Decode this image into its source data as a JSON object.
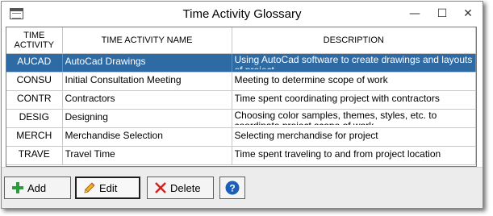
{
  "window": {
    "title": "Time Activity Glossary",
    "controls": {
      "minimize": "—",
      "maximize": "☐",
      "close": "✕"
    }
  },
  "table": {
    "columns": [
      "TIME ACTIVITY",
      "TIME ACTIVITY NAME",
      "DESCRIPTION"
    ],
    "rows": [
      {
        "code": "AUCAD",
        "name": "AutoCad Drawings",
        "description": "Using AutoCad software to create drawings and layouts of project",
        "selected": true
      },
      {
        "code": "CONSU",
        "name": "Initial Consultation Meeting",
        "description": "Meeting to determine scope of work",
        "selected": false
      },
      {
        "code": "CONTR",
        "name": "Contractors",
        "description": "Time spent coordinating project with contractors",
        "selected": false
      },
      {
        "code": "DESIG",
        "name": "Designing",
        "description": "Choosing color samples, themes, styles, etc. to coordinate project scope of work",
        "selected": false
      },
      {
        "code": "MERCH",
        "name": "Merchandise Selection",
        "description": "Selecting merchandise for project",
        "selected": false
      },
      {
        "code": "TRAVE",
        "name": "Travel Time",
        "description": "Time spent traveling to and from project location",
        "selected": false
      }
    ]
  },
  "buttons": {
    "add": "Add",
    "edit": "Edit",
    "delete": "Delete",
    "help": "?"
  },
  "colors": {
    "selection": "#2e6aa3",
    "add_icon": "#2e9a3e",
    "delete_icon": "#d62020",
    "help_icon": "#1b5fb8"
  }
}
